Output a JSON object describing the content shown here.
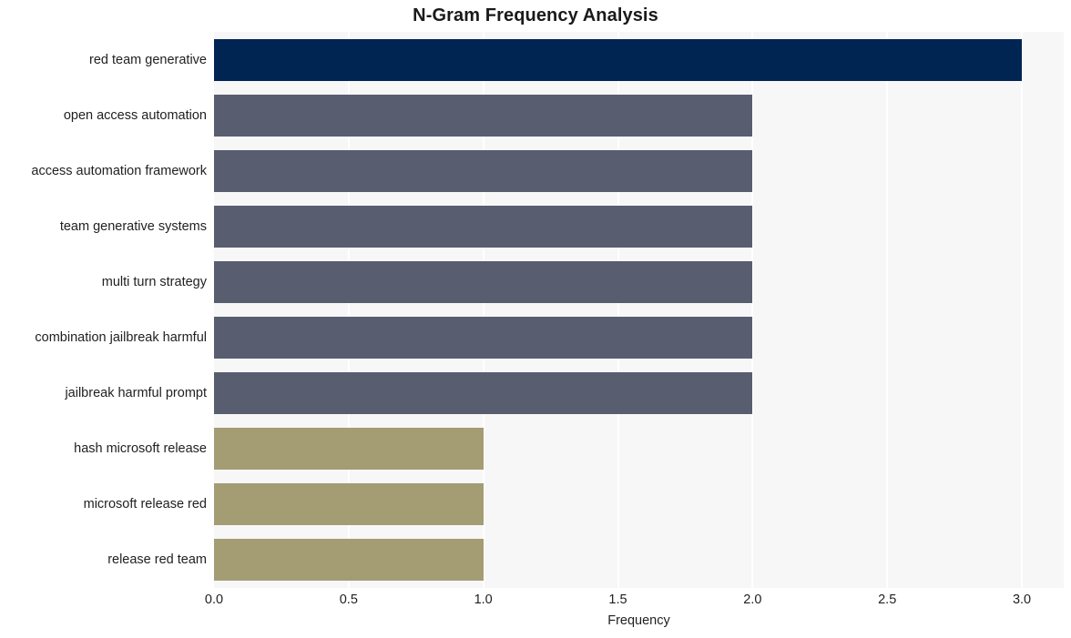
{
  "chart_data": {
    "type": "bar",
    "orientation": "horizontal",
    "title": "N-Gram Frequency Analysis",
    "xlabel": "Frequency",
    "ylabel": "",
    "categories": [
      "red team generative",
      "open access automation",
      "access automation framework",
      "team generative systems",
      "multi turn strategy",
      "combination jailbreak harmful",
      "jailbreak harmful prompt",
      "hash microsoft release",
      "microsoft release red",
      "release red team"
    ],
    "values": [
      3,
      2,
      2,
      2,
      2,
      2,
      2,
      1,
      1,
      1
    ],
    "bar_colors": [
      "#012553",
      "#585e70",
      "#585e70",
      "#585e70",
      "#585e70",
      "#585e70",
      "#585e70",
      "#a49c73",
      "#a49c73",
      "#a49c73"
    ],
    "xlim": [
      0.0,
      3.1554
    ],
    "xticks": [
      0.0,
      0.5,
      1.0,
      1.5,
      2.0,
      2.5,
      3.0
    ],
    "xtick_labels": [
      "0.0",
      "0.5",
      "1.0",
      "1.5",
      "2.0",
      "2.5",
      "3.0"
    ],
    "grid": true,
    "grid_axis": "x",
    "grid_color": "#ffffff",
    "plot_background": "#f7f7f8",
    "figure_background": "#ffffff",
    "legend": null,
    "legend_position": "none",
    "annotations": []
  }
}
